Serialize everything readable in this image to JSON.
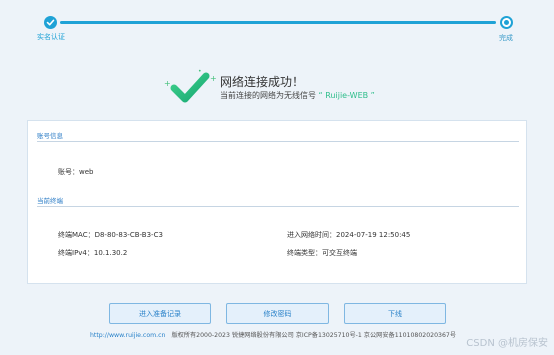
{
  "progress": {
    "steps": [
      {
        "label": "实名认证",
        "state": "done"
      },
      {
        "label": "完成",
        "state": "current"
      }
    ]
  },
  "status": {
    "title": "网络连接成功！",
    "subtitle_prefix": "当前连接的网络为无线信号",
    "ssid_quoted": "“ Ruijie-WEB ”"
  },
  "account": {
    "section_title": "账号信息",
    "account_line": "账号：web"
  },
  "terminal": {
    "section_title": "当前终端",
    "mac_line": "终端MAC：D8-80-83-CB-B3-C3",
    "ip_line": "终端IPv4：10.1.30.2",
    "login_time_line": "进入网络时间：2024-07-19 12:50:45",
    "type_line": "终端类型：可交互终端"
  },
  "actions": {
    "buttons": [
      "进入准备记录",
      "修改密码",
      "下线"
    ]
  },
  "footer": {
    "link": "http://www.ruijie.com.cn",
    "copyright": "版权所有2000-2023 锐捷网络股份有限公司 京ICP备13025710号-1 京公网安备11010802020367号"
  },
  "watermark": "CSDN @机房保安",
  "colors": {
    "accent": "#1fa2d6",
    "success": "#2dbd8a",
    "link": "#2a82c9",
    "background": "#edf3f9"
  }
}
